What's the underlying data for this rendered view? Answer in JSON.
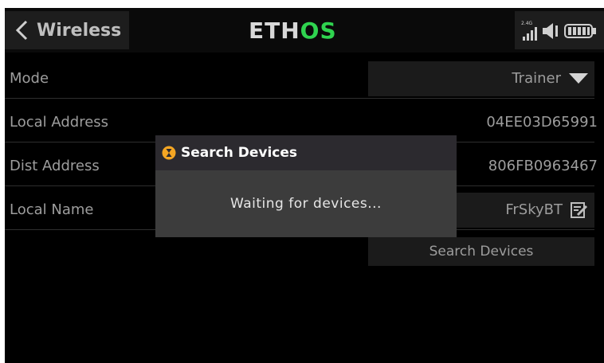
{
  "header": {
    "back_title": "Wireless",
    "brand_part1": "ETH",
    "brand_part2": "OS",
    "rf_label": "2.4G"
  },
  "rows": {
    "mode": {
      "label": "Mode",
      "value": "Trainer"
    },
    "local_address": {
      "label": "Local Address",
      "value": "04EE03D65991"
    },
    "dist_address": {
      "label": "Dist Address",
      "value": "806FB0963467"
    },
    "local_name": {
      "label": "Local Name",
      "value": "FrSkyBT"
    }
  },
  "search_button": "Search Devices",
  "dialog": {
    "title": "Search Devices",
    "message": "Waiting for devices..."
  },
  "colors": {
    "background": "#000000",
    "accent_green": "#2fd34f",
    "hourglass": "#f5a623",
    "dialog_body": "#3c3c3c",
    "dialog_header": "#2c2a2f"
  }
}
